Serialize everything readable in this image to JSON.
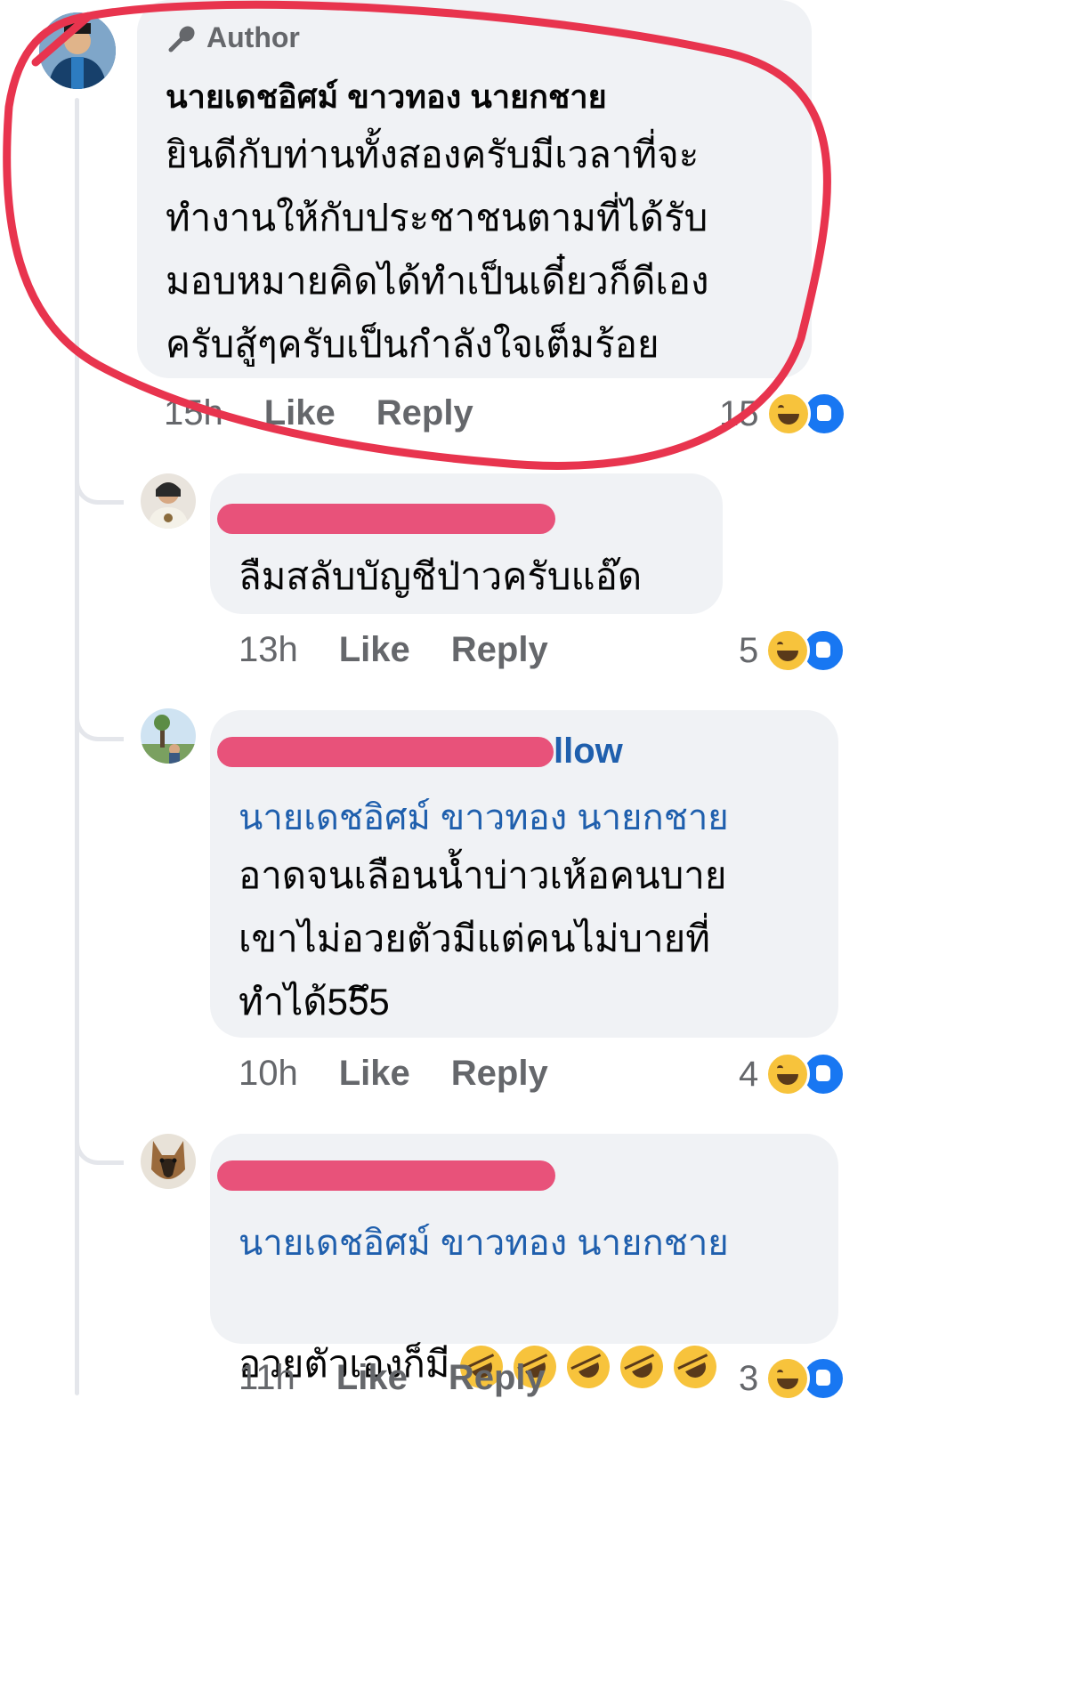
{
  "colors": {
    "bubble": "#f0f2f5",
    "meta_text": "#65676b",
    "tag_blue": "#1f5fad",
    "redact_pink": "#e8527a",
    "circle_red": "#e8344e"
  },
  "comment_1": {
    "badge": "Author",
    "author": "นายเดชอิศม์ ขาวทอง นายกชาย",
    "text": "ยินดีกับท่านทั้งสองครับมีเวลาที่จะ\nทำงานให้กับประชาชนตามที่ได้รับ\nมอบหมายคิดได้ทำเป็นเดี๋ยวก็ดีเอง\nครับสู้ๆครับเป็นกำลังใจเต็มร้อย",
    "time": "15h",
    "like": "Like",
    "reply": "Reply",
    "reaction_count": "15"
  },
  "comment_2": {
    "text": "ลืมสลับบัญชีป่าวครับแอ๊ด",
    "time": "13h",
    "like": "Like",
    "reply": "Reply",
    "reaction_count": "5"
  },
  "comment_3": {
    "name_tail": "llow",
    "tag": "นายเดชอิศม์ ขาวทอง นายกชาย",
    "text": "อาดจนเลือนน้ำบ่าวเห้อคนบาย\nเขาไม่อวยตัวมีแต่คนไม่บายที่\nทำได้55ึ5",
    "time": "10h",
    "like": "Like",
    "reply": "Reply",
    "reaction_count": "4"
  },
  "comment_4": {
    "tag": "นายเดชอิศม์ ขาวทอง นายกชาย",
    "text": "อวยตัวเองก็มี",
    "emoji_name": "rolling-on-floor-laughing-icon",
    "time": "11h",
    "like": "Like",
    "reply": "Reply",
    "reaction_count": "3"
  }
}
